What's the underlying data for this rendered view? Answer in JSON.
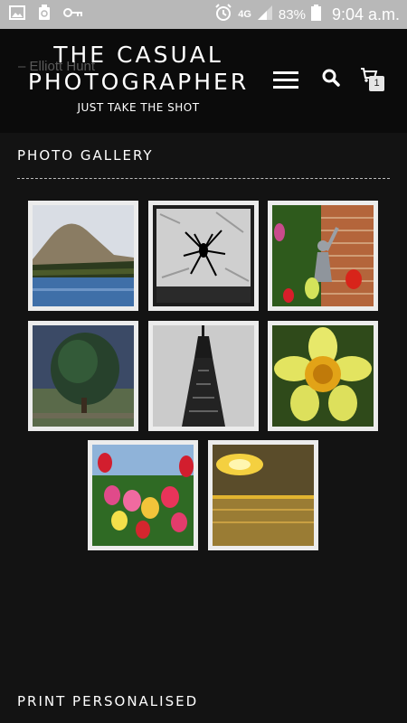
{
  "status_bar": {
    "network": "4G",
    "battery": "83%",
    "time": "9:04 a.m."
  },
  "header": {
    "ghost_text": "– Elliott Hunt",
    "title_line1": "THE CASUAL",
    "title_line2": "PHOTOGRAPHER",
    "tagline": "JUST TAKE THE SHOT",
    "cart_count": "1"
  },
  "gallery": {
    "title": "PHOTO GALLERY",
    "photos": [
      "hill-lake",
      "spider",
      "statue",
      "tree",
      "tower",
      "daffodil",
      "tulips",
      "sunset-beach"
    ]
  },
  "footer": {
    "title": "PRINT PERSONALISED"
  }
}
